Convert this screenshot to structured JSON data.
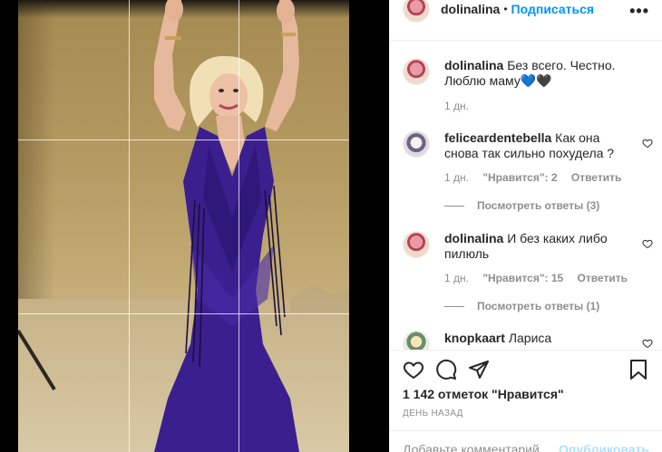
{
  "post": {
    "username": "dolinalina",
    "follow_label": "Подписаться",
    "more_label": "•••"
  },
  "comments": [
    {
      "username": "dolinalina",
      "text": "Без всего. Честно. Люблю маму💙🖤",
      "time": "1 дн."
    },
    {
      "username": "feliceardentebella",
      "text": "Как она снова так сильно похудела ?",
      "time": "1 дн.",
      "likes": "\"Нравится\": 2",
      "reply_label": "Ответить",
      "view_replies": "Посмотреть ответы (3)"
    },
    {
      "username": "dolinalina",
      "text": "И без каких либо пилюль",
      "time": "1 дн.",
      "likes": "\"Нравится\": 15",
      "reply_label": "Ответить",
      "view_replies": "Посмотреть ответы (1)"
    },
    {
      "username": "knopkaart",
      "text": "Лариса"
    }
  ],
  "likes_count": "1 142 отметок \"Нравится\"",
  "date_label": "ДЕНЬ НАЗАД",
  "add_comment_placeholder": "Добавьте комментарий...",
  "publish_label": "Опубликовать",
  "colors": {
    "link_blue": "#0095f6",
    "text": "#262626",
    "muted": "#8e8e8e",
    "publish_disabled": "#b2dffc",
    "dress": "#3b1f8f"
  }
}
